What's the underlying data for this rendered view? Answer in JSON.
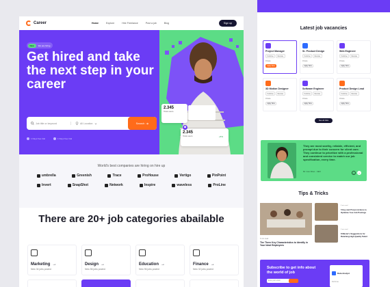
{
  "nav": {
    "brand": "Career",
    "items": [
      "Home",
      "Explore",
      "Hire Freelance",
      "Post a job",
      "Blog"
    ],
    "signup": "Sign up"
  },
  "hero": {
    "pill_badge": "New",
    "pill_text": "We are hiring",
    "headline": "Get hired and take the next step in your career",
    "search_placeholder": "Job title or keyword",
    "location_placeholder": "All Location",
    "search_button": "Search",
    "features": [
      "1 Days free trial",
      "1 Days free trial"
    ],
    "stat1_value": "2.345",
    "stat1_label": "Total users",
    "stat1_badge": "+5%",
    "stat2_value": "2.345",
    "stat2_label": "Total users",
    "stat2_badge": "+5%",
    "colors": {
      "purple": "#6b3cf5",
      "green": "#5cdc86",
      "orange": "#ff6b1a"
    }
  },
  "companies": {
    "title": "World's best companies are hiring on hire up",
    "row1": [
      "umbrella",
      "Greenish",
      "Trace",
      "ProHouse",
      "Vertigo",
      "PinPoint"
    ],
    "row2": [
      "Invert",
      "SnapShot",
      "Network",
      "Inspire",
      "waveless",
      "ProLine"
    ]
  },
  "categories": {
    "title": "There are 20+ job categories abailable",
    "items": [
      {
        "name": "Marketing",
        "count": "New 34 jobs posted",
        "icon": "monitor-icon"
      },
      {
        "name": "Design",
        "count": "New 56 jobs posted",
        "icon": "pen-icon"
      },
      {
        "name": "Education",
        "count": "New 96 jobs posted",
        "icon": "book-icon"
      },
      {
        "name": "Finance",
        "count": "New 32 jobs posted",
        "icon": "chart-icon"
      }
    ]
  },
  "vacancies": {
    "title": "Latest job vacancies",
    "jobs": [
      {
        "title": "Project Manager",
        "tags": [
          "Full-time",
          "Remote"
        ],
        "location": "Dhaka",
        "apply": "Apply Now",
        "color": "#6b3cf5"
      },
      {
        "title": "Sr. Product Design",
        "tags": [
          "Full-time",
          "Remote"
        ],
        "location": "Dhaka",
        "apply": "Apply Now",
        "color": "#2d6bff"
      },
      {
        "title": "Web Engineer",
        "tags": [
          "Full-time",
          "Remote"
        ],
        "location": "Dhaka",
        "apply": "Apply Now",
        "color": "#6b3cf5"
      },
      {
        "title": "3D Motion Designer",
        "tags": [
          "Full-time",
          "Remote"
        ],
        "location": "Dhaka",
        "apply": "Apply Now",
        "color": "#ff6b1a"
      },
      {
        "title": "Software Engineer",
        "tags": [
          "Full-time",
          "Remote"
        ],
        "location": "Dhaka",
        "apply": "Apply Now",
        "color": "#6b3cf5"
      },
      {
        "title": "Product Design Lead",
        "tags": [
          "Full-time",
          "Remote"
        ],
        "location": "Dhaka",
        "apply": "Apply Now",
        "color": "#ff6b1a"
      }
    ],
    "see_all": "See all Jobs"
  },
  "testimonial": {
    "quote": "They are most worthy, reliable, efficient, and prompt due to their concern for client care. They continue to prioritize with a professional and consistent service to match our job specification, every time.",
    "author": "Mr. Gon Khan",
    "role": "CEO"
  },
  "tips": {
    "title": "Tips & Tricks",
    "main_meta": "6 min read",
    "main_title": "The Three Key Characteristics to Identify in Your Ideal Employees",
    "side": [
      {
        "meta": "6 min read",
        "title": "5 Key and Proven Actions to Optimize Your Job Postings"
      },
      {
        "meta": "6 min read",
        "title": "8 Master's Suggestions for Retaining High-Quality Talent"
      }
    ]
  },
  "newsletter": {
    "title": "Subscribe to get info about the world of job",
    "input_placeholder": "Enter your email",
    "card_title": "Data Analyst",
    "card_sub": "Full time"
  }
}
